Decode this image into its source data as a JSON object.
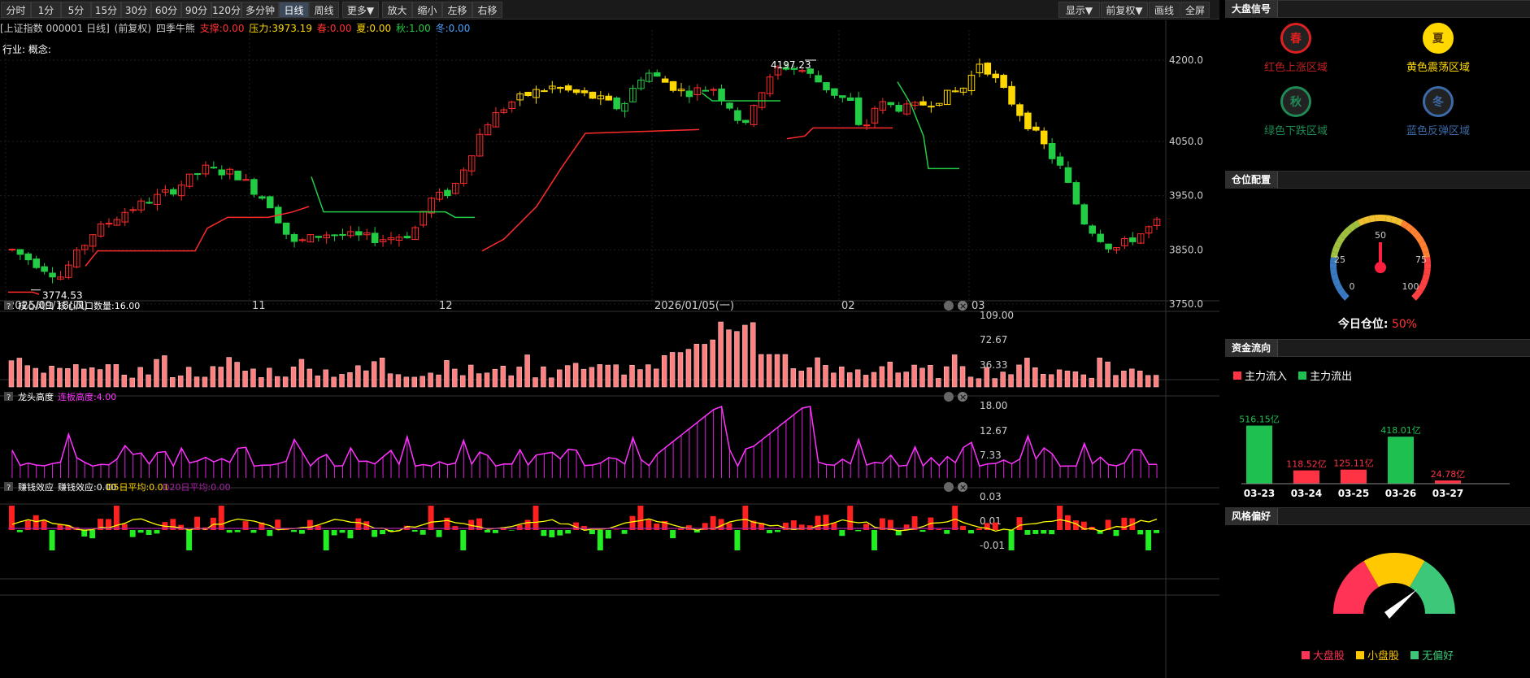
{
  "toolbar": {
    "left": [
      "分时",
      "1分",
      "5分",
      "15分",
      "30分",
      "60分",
      "90分",
      "120分",
      "多分钟",
      "日线",
      "周线",
      "更多▼",
      "放大",
      "缩小",
      "左移",
      "右移"
    ],
    "active": "日线",
    "right": [
      "显示▼",
      "前复权▼",
      "画线",
      "全屏"
    ]
  },
  "info": {
    "stock": "[上证指数 000001 日线]",
    "fq": "(前复权)",
    "ind": "四季牛熊",
    "support": "支撑:0.00",
    "pressure": "压力:3973.19",
    "spring": "春:0.00",
    "summer": "夏:0.00",
    "autumn": "秋:1.00",
    "winter": "冬:0.00",
    "industry": "行业: 概念:"
  },
  "main": {
    "high_label": "4197.23",
    "low_label": "3774.53",
    "yticks": [
      "4200.0",
      "4050.0",
      "3950.0",
      "3850.0",
      "3750.0"
    ],
    "dates": [
      "2025/09/18(四)",
      "11",
      "12",
      "2026/01/05(一)",
      "02",
      "03"
    ]
  },
  "panels": {
    "p1": {
      "q": "?",
      "title": "核心风口",
      "metric": "核心风口数量:16.00",
      "ticks": [
        "109.00",
        "72.67",
        "36.33"
      ]
    },
    "p2": {
      "q": "?",
      "title": "龙头高度",
      "metric": "连板高度:4.00",
      "ticks": [
        "18.00",
        "12.67",
        "7.33"
      ]
    },
    "p3": {
      "q": "?",
      "title": "赚钱效应",
      "metric": "赚钱效应:0.00",
      "d5": "D5日平均:0.01",
      "d20": "D20日平均:0.00",
      "ticks": [
        "0.03",
        "0.01",
        "-0.01"
      ]
    }
  },
  "right": {
    "signal_title": "大盘信号",
    "signals": [
      {
        "glyph": "春",
        "label": "红色上涨区域",
        "color": "#e02020"
      },
      {
        "glyph": "夏",
        "label": "黄色震荡区域",
        "color": "#ffd800"
      },
      {
        "glyph": "秋",
        "label": "绿色下跌区域",
        "color": "#1f8a55"
      },
      {
        "glyph": "冬",
        "label": "蓝色反弹区域",
        "color": "#3c6aa8"
      }
    ],
    "pos_title": "仓位配置",
    "gauge": {
      "ticks": [
        "0",
        "25",
        "50",
        "75",
        "100"
      ],
      "label": "今日仓位:",
      "value": "50%",
      "pct": 50
    },
    "flow_title": "资金流向",
    "flow_legend": [
      "主力流入",
      "主力流出"
    ],
    "flow": [
      {
        "date": "03-23",
        "label": "516.15亿",
        "value": 516.15,
        "type": "out"
      },
      {
        "date": "03-24",
        "label": "118.52亿",
        "value": 118.52,
        "type": "in"
      },
      {
        "date": "03-25",
        "label": "125.11亿",
        "value": 125.11,
        "type": "in"
      },
      {
        "date": "03-26",
        "label": "418.01亿",
        "value": 418.01,
        "type": "out"
      },
      {
        "date": "03-27",
        "label": "24.78亿",
        "value": 24.78,
        "type": "in"
      }
    ],
    "style_title": "风格偏好",
    "style_legend": [
      "大盘股",
      "小盘股",
      "无偏好"
    ]
  }
}
